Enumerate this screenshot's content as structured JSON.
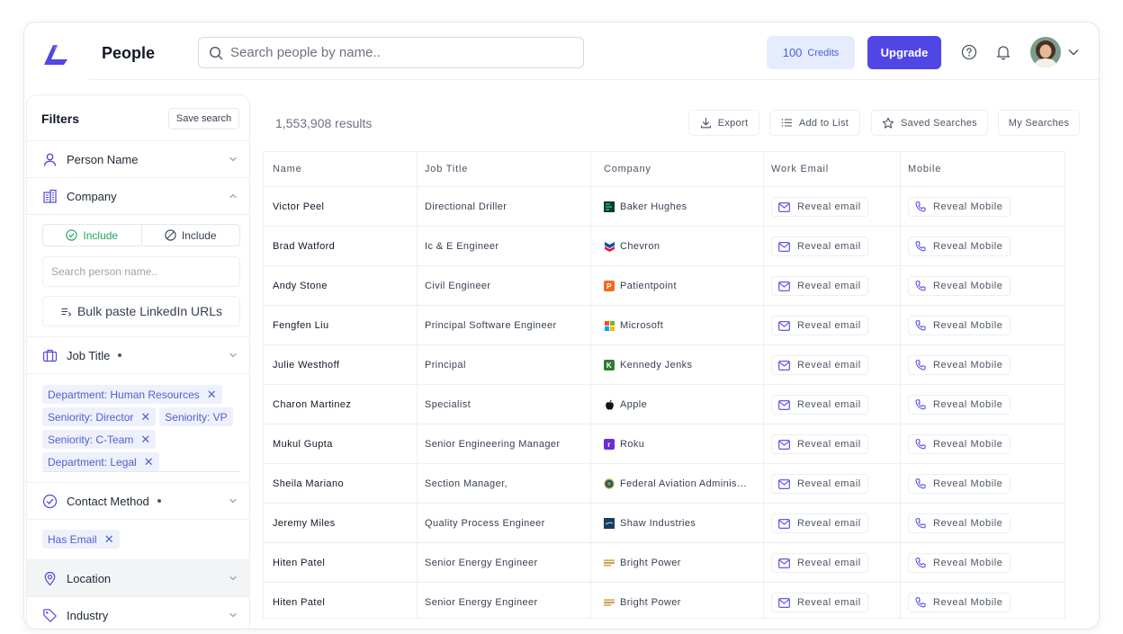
{
  "header": {
    "title": "People",
    "search_placeholder": "Search people by name..",
    "credits_value": "100",
    "credits_label": "Credits",
    "upgrade_label": "Upgrade"
  },
  "sidebar": {
    "title": "Filters",
    "save_search": "Save search",
    "sections": {
      "person_name": "Person Name",
      "company": "Company",
      "job_title": "Job Title",
      "contact_method": "Contact Method",
      "location": "Location",
      "industry": "Industry"
    },
    "include_on": "Include",
    "include_off": "Include",
    "company_search_placeholder": "Search person name..",
    "bulk_paste": "Bulk paste LinkedIn URLs",
    "job_tags": [
      "Department: Human Resources",
      "Seniority: Director",
      "Seniority: VP",
      "Seniority: C-Team",
      "Department: Legal"
    ],
    "contact_tags": [
      "Has Email"
    ]
  },
  "main": {
    "results": "1,553,908 results",
    "toolbar": {
      "export": "Export",
      "add_to_list": "Add to List",
      "saved_searches": "Saved Searches",
      "my_searches": "My Searches"
    },
    "columns": [
      "Name",
      "Job Title",
      "Company",
      "Work Email",
      "Mobile"
    ],
    "reveal_email": "Reveal email",
    "reveal_mobile": "Reveal Mobile",
    "rows": [
      {
        "name": "Victor Peel",
        "title": "Directional Driller",
        "company": "Baker Hughes",
        "logo": "baker-hughes",
        "logo_color": "#0b5d3f"
      },
      {
        "name": "Brad Watford",
        "title": "Ic & E Engineer",
        "company": "Chevron",
        "logo": "chevron",
        "logo_color": "#0054a4"
      },
      {
        "name": "Andy Stone",
        "title": "Civil Engineer",
        "company": "Patientpoint",
        "logo": "patientpoint",
        "logo_color": "#f26b1d"
      },
      {
        "name": "Fengfen Liu",
        "title": "Principal Software Engineer",
        "company": "Microsoft",
        "logo": "microsoft",
        "logo_color": "#f25022"
      },
      {
        "name": "Julie Westhoff",
        "title": "Principal",
        "company": "Kennedy Jenks",
        "logo": "kennedy-jenks",
        "logo_color": "#2e7d32"
      },
      {
        "name": "Charon Martinez",
        "title": "Specialist",
        "company": "Apple",
        "logo": "apple",
        "logo_color": "#111111"
      },
      {
        "name": "Mukul Gupta",
        "title": "Senior Engineering Manager",
        "company": "Roku",
        "logo": "roku",
        "logo_color": "#6c2bd9"
      },
      {
        "name": "Sheila Mariano",
        "title": "Section Manager,",
        "company": "Federal Aviation Administration",
        "logo": "faa",
        "logo_color": "#1f4e79"
      },
      {
        "name": "Jeremy Miles",
        "title": "Quality Process Engineer",
        "company": "Shaw Industries",
        "logo": "shaw",
        "logo_color": "#1d3b5a"
      },
      {
        "name": "Hiten Patel",
        "title": "Senior Energy Engineer",
        "company": "Bright Power",
        "logo": "bright-power",
        "logo_color": "#f4a72b"
      },
      {
        "name": "Hiten Patel",
        "title": "Senior Energy Engineer",
        "company": "Bright Power",
        "logo": "bright-power",
        "logo_color": "#f4a72b"
      }
    ]
  },
  "colors": {
    "accent": "#4f46e5",
    "include_green": "#22a45d",
    "tag_text": "#4f5fcf",
    "tag_bg": "#eef1fb",
    "credits_bg": "#e5edfc"
  }
}
